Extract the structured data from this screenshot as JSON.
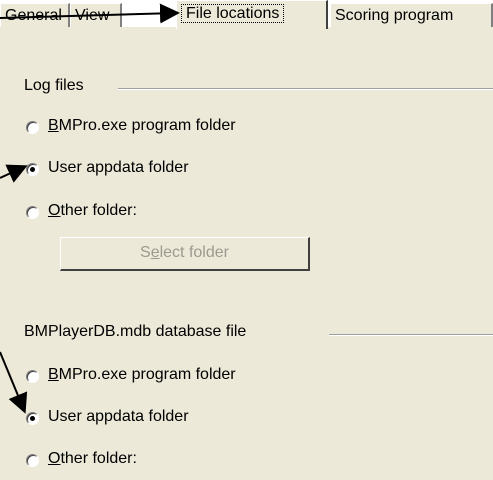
{
  "tabs": [
    {
      "label": "General"
    },
    {
      "label": "View"
    },
    {
      "label": "File locations",
      "active": true
    },
    {
      "label": "Scoring program"
    }
  ],
  "log_files": {
    "title": "Log files",
    "options": [
      {
        "mnemonic": "B",
        "rest": "MPro.exe program folder",
        "checked": false
      },
      {
        "mnemonic": "",
        "rest": "User appdata folder",
        "checked": true
      },
      {
        "mnemonic": "O",
        "rest": "ther folder:",
        "checked": false
      }
    ],
    "select_button": {
      "pre": "S",
      "mnemonic": "e",
      "post": "lect folder"
    }
  },
  "database_file": {
    "title": "BMPlayerDB.mdb database file",
    "options": [
      {
        "mnemonic": "B",
        "rest": "MPro.exe program folder",
        "checked": false
      },
      {
        "mnemonic": "",
        "rest": "User appdata folder",
        "checked": true
      },
      {
        "mnemonic": "O",
        "rest": "ther folder:",
        "checked": false
      }
    ]
  },
  "colors": {
    "panel": "#ece9d8",
    "disabled_text": "#9c9a8f"
  }
}
